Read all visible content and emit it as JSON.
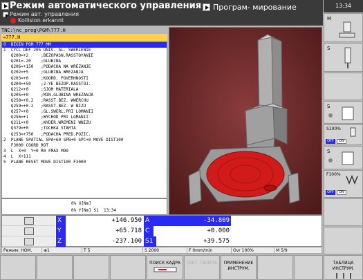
{
  "header": {
    "mode_title": "Режим автоматического управления",
    "mode_subtitle": "Режим авт. управления",
    "warning_text": "Kollision erkannt",
    "secondary_mode": "Програм- мирование"
  },
  "clock": "13:34",
  "program": {
    "path": "TNC:\\nc_prog\\PGM\\777.H",
    "name": "→777.H",
    "lines": [
      "0  BEGIN PGM 777 MM",
      "1  CYCL DEF 205 UNIV. GL. SWERLENIE",
      "   Q200=+2     ;BEZOPASN.RASSTOYANIE",
      "   Q201=-20    ;GLUBINA",
      "   Q206=+150   ;PODACHA NA WREZANJE",
      "   Q202=+5     ;GLUBINA WREZANJA",
      "   Q203=+0     ;KOORD. POVERHNOSTI",
      "   Q204=+50    ;2-YE BEZOP.RASSTOJ.",
      "   Q212=+0     ;SJOM MATERIALA",
      "   Q205=+0     ;MIN.GLUBINA WREZANJA",
      "   Q258=+0.2   ;RASST.BEZ. WWERCHU",
      "   Q259=+0.2   ;RASST.BEZ. W NIZU",
      "   Q257=+0     ;GL.SWERL.PRI LOMANII",
      "   Q256=+1     ;WYCHOD PRI LOMANII",
      "   Q211=+0     ;WYDER.WREMENI WNIZU",
      "   Q379=+0     ;TOCHKA STARTA",
      "   Q253=+750   ;PODACHA PRED.POZIC.",
      "2  PLANE SPATIAL SPA+60 SPB+0 SPC+0 MOVE DIST100",
      "   F3000 COORD ROT",
      "3  L  X+0  Y+0 R0 FMAX M99",
      "4  L  X+111",
      "5  PLANE RESET MOVE DIST100 F3000",
      "",
      ""
    ],
    "status_x": "0% X[Nm]",
    "status_y": "0% Y[Nm] S1  13:34"
  },
  "positions": {
    "X": "+146.950",
    "Y": "+65.718",
    "Z": "-237.100",
    "A": "-34.809",
    "C": "+0.000",
    "S1": "+39.575",
    "labels": {
      "x": "X",
      "y": "Y",
      "z": "Z",
      "a": "A",
      "c": "C",
      "s1": "S1"
    }
  },
  "statusbar": {
    "mode": "Режим: НОМ.",
    "tool_slot": "⊕1",
    "tool": "T 5",
    "spindle": "S 2000",
    "feed": "F 0mm/min",
    "override": "Ovr 100%",
    "mfunc": "M 5/9"
  },
  "right_softkeys": {
    "m": "M",
    "s1": "S",
    "s2": "S",
    "pct1": "S100%",
    "pct2": "F100%",
    "off": "OFF",
    "on": "ON"
  },
  "bottom_softkeys": {
    "search": "ПОИСК КАДРА",
    "tool_table_dim": "СЕКТ. ПАЛЕТА",
    "apply": "ПРИМЕНЕНИЕ ИНСТРУМ.",
    "tool_table": "ТАБЛИЦА ИНСТРУМ."
  }
}
